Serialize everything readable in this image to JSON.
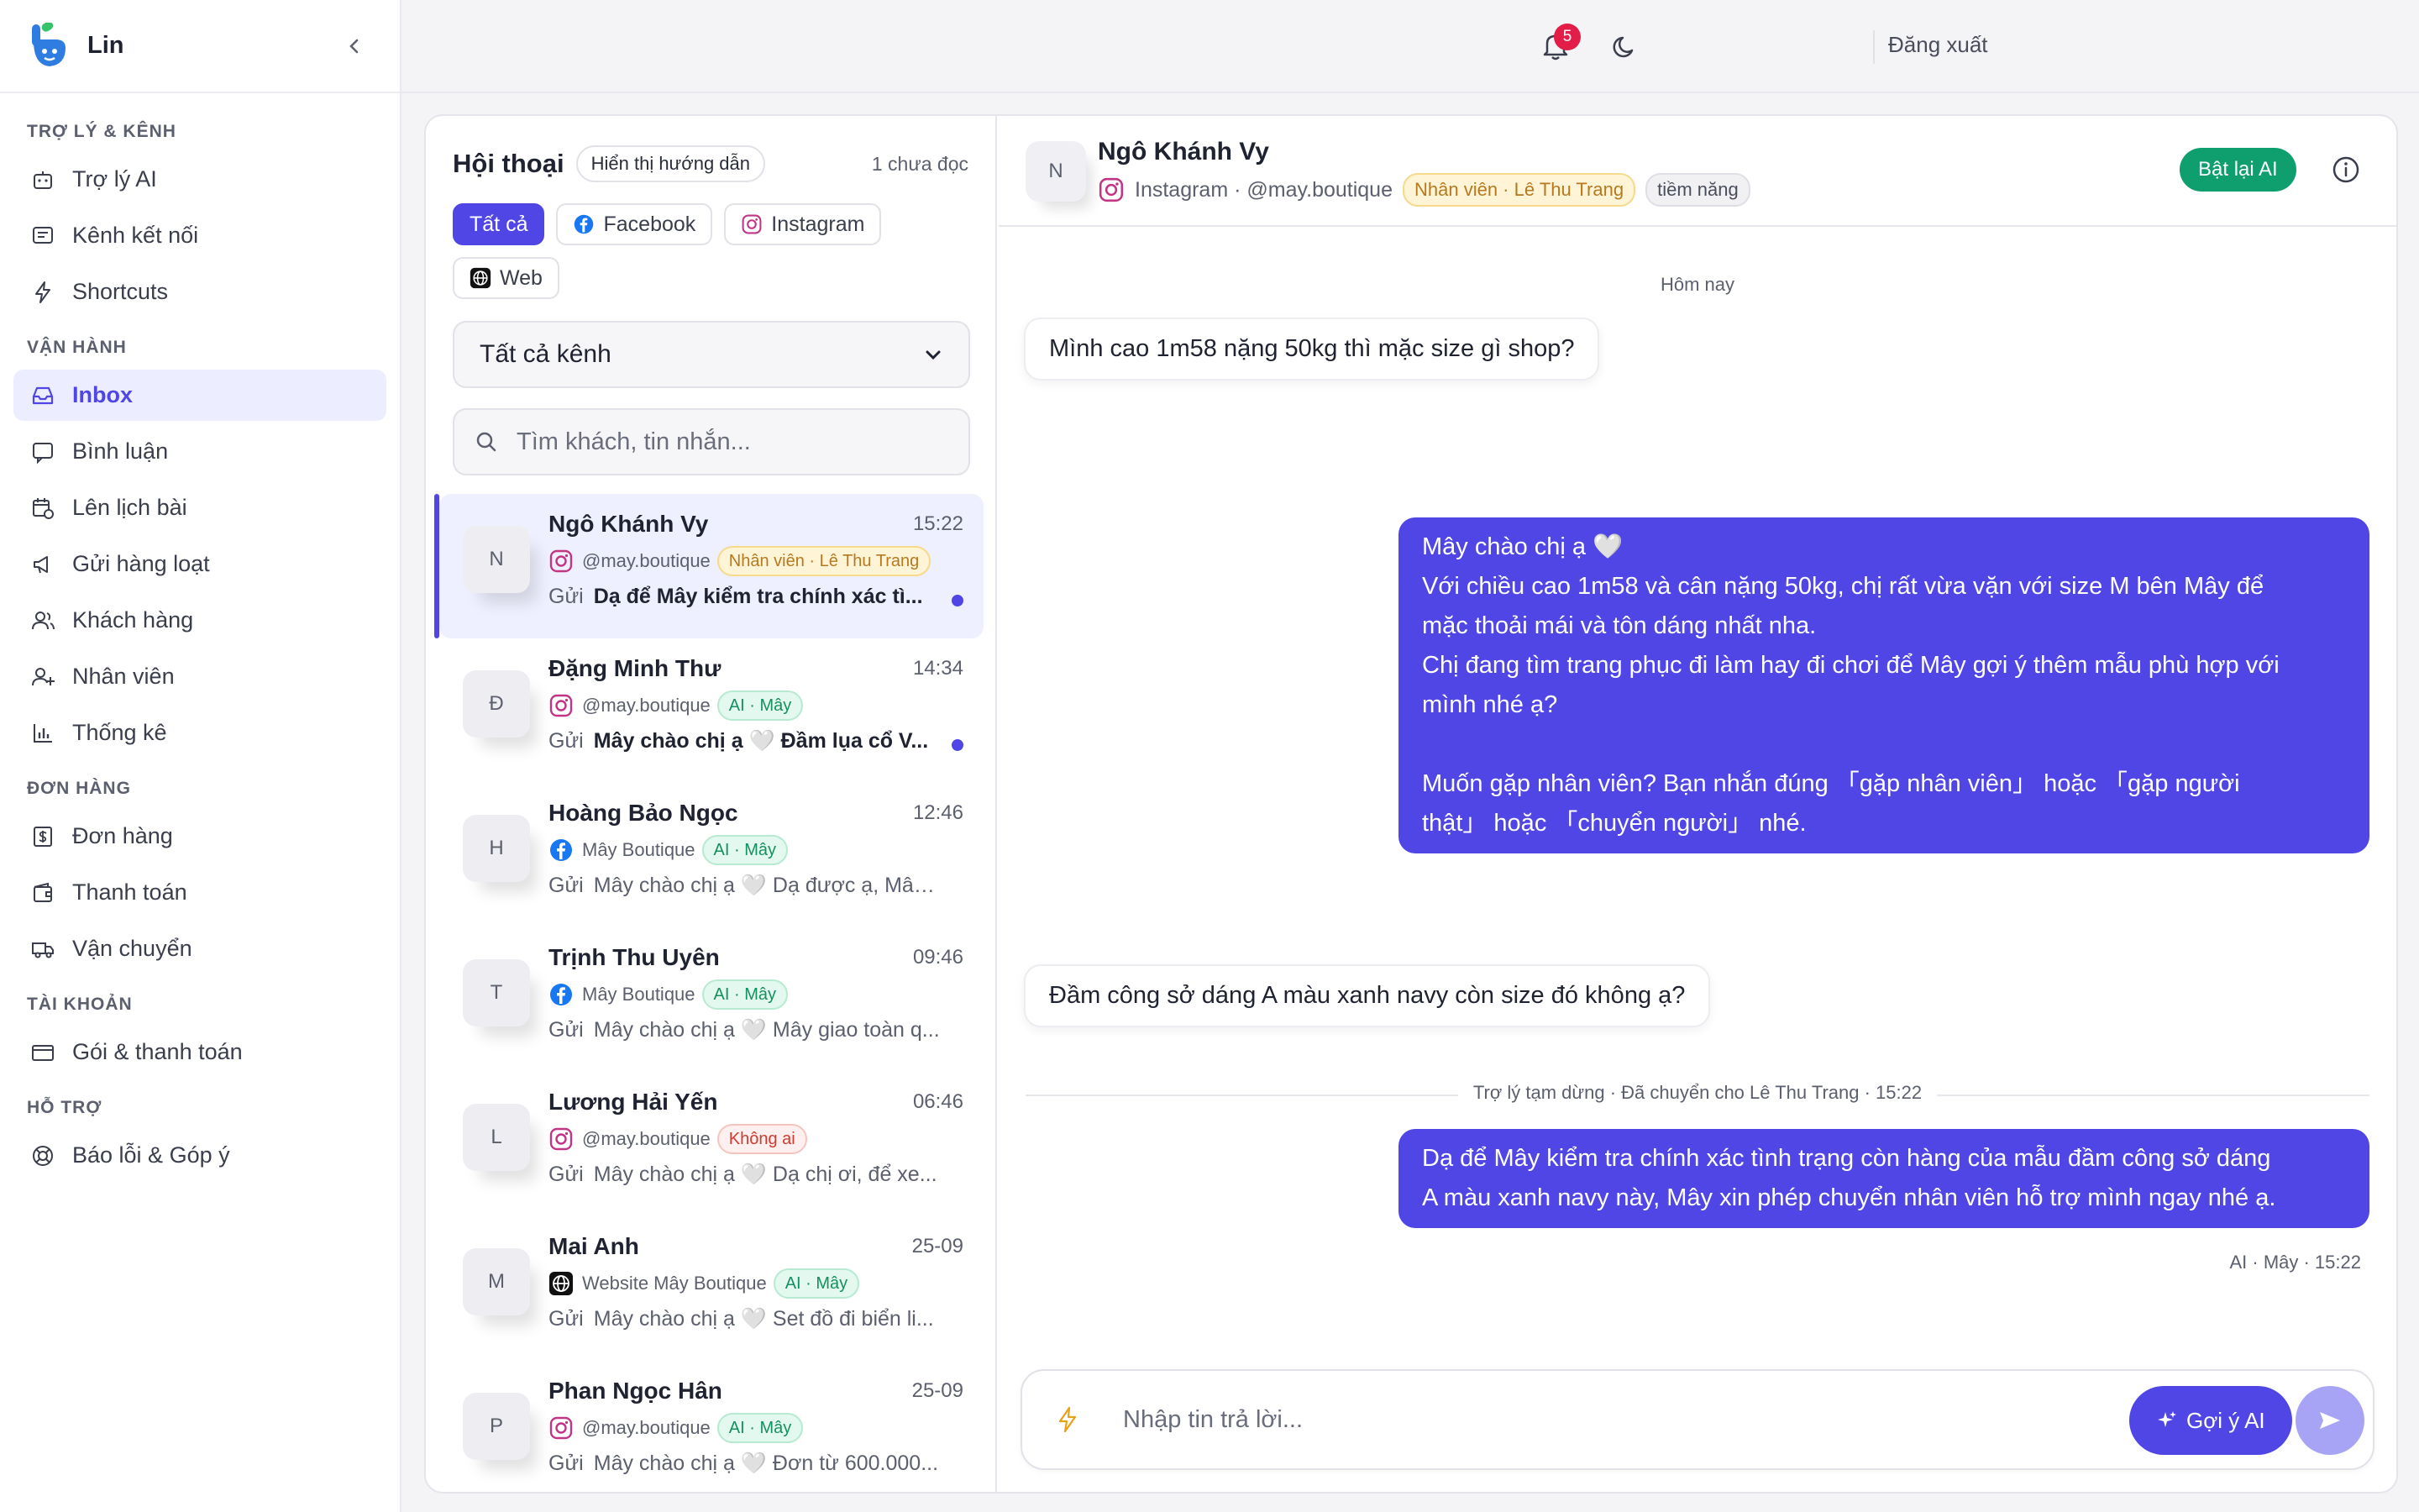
{
  "brand": {
    "name": "Lin"
  },
  "nav": {
    "sections": [
      {
        "title": "TRỢ LÝ & KÊNH",
        "items": [
          {
            "label": "Trợ lý AI",
            "icon": "bot-icon"
          },
          {
            "label": "Kênh kết nối",
            "icon": "chat-square-icon"
          },
          {
            "label": "Shortcuts",
            "icon": "lightning-icon"
          }
        ]
      },
      {
        "title": "VẬN HÀNH",
        "items": [
          {
            "label": "Inbox",
            "icon": "inbox-icon",
            "active": true
          },
          {
            "label": "Bình luận",
            "icon": "comment-icon"
          },
          {
            "label": "Lên lịch bài",
            "icon": "calendar-clock-icon"
          },
          {
            "label": "Gửi hàng loạt",
            "icon": "megaphone-icon"
          },
          {
            "label": "Khách hàng",
            "icon": "users-icon"
          },
          {
            "label": "Nhân viên",
            "icon": "user-plus-icon"
          },
          {
            "label": "Thống kê",
            "icon": "bar-chart-icon"
          }
        ]
      },
      {
        "title": "ĐƠN HÀNG",
        "items": [
          {
            "label": "Đơn hàng",
            "icon": "receipt-icon"
          },
          {
            "label": "Thanh toán",
            "icon": "wallet-icon"
          },
          {
            "label": "Vận chuyển",
            "icon": "truck-icon"
          }
        ]
      },
      {
        "title": "TÀI KHOẢN",
        "items": [
          {
            "label": "Gói & thanh toán",
            "icon": "credit-card-icon"
          }
        ]
      },
      {
        "title": "HỖ TRỢ",
        "items": [
          {
            "label": "Báo lỗi & Góp ý",
            "icon": "lifebuoy-icon"
          }
        ]
      }
    ]
  },
  "topbar": {
    "notification_count": "5",
    "logout_label": "Đăng xuất"
  },
  "conversations_panel": {
    "title": "Hội thoại",
    "guide_label": "Hiển thị hướng dẫn",
    "unread_label": "1 chưa đọc",
    "filters": [
      {
        "label": "Tất cả",
        "active": true,
        "icon": ""
      },
      {
        "label": "Facebook",
        "icon": "facebook-icon"
      },
      {
        "label": "Instagram",
        "icon": "instagram-icon"
      },
      {
        "label": "Web",
        "icon": "globe-icon"
      }
    ],
    "channel_select": "Tất cả kênh",
    "search_placeholder": "Tìm khách, tin nhắn...",
    "items": [
      {
        "initial": "N",
        "name": "Ngô Khánh Vy",
        "time": "15:22",
        "channel": "instagram-icon",
        "account": "@may.boutique",
        "tag": "Nhân viên · Lê Thu Trang",
        "tag_color": "amber",
        "sent": "Gửi",
        "last": "Dạ để Mây kiểm tra chính xác tì...",
        "unread": true,
        "active": true
      },
      {
        "initial": "Đ",
        "name": "Đặng Minh Thư",
        "time": "14:34",
        "channel": "instagram-icon",
        "account": "@may.boutique",
        "tag": "AI · Mây",
        "tag_color": "green",
        "sent": "Gửi",
        "last": "Mây chào chị ạ 🤍 Đầm lụa cổ V...",
        "unread": true
      },
      {
        "initial": "H",
        "name": "Hoàng Bảo Ngọc",
        "time": "12:46",
        "channel": "facebook-icon",
        "account": "Mây Boutique",
        "tag": "AI · Mây",
        "tag_color": "green",
        "sent": "Gửi",
        "last": "Mây chào chị ạ 🤍 Dạ được ạ, Mây ...",
        "unread": false
      },
      {
        "initial": "T",
        "name": "Trịnh Thu Uyên",
        "time": "09:46",
        "channel": "facebook-icon",
        "account": "Mây Boutique",
        "tag": "AI · Mây",
        "tag_color": "green",
        "sent": "Gửi",
        "last": "Mây chào chị ạ 🤍 Mây giao toàn q...",
        "unread": false
      },
      {
        "initial": "L",
        "name": "Lương Hải Yến",
        "time": "06:46",
        "channel": "instagram-icon",
        "account": "@may.boutique",
        "tag": "Không ai",
        "tag_color": "red",
        "sent": "Gửi",
        "last": "Mây chào chị ạ 🤍 Dạ chị ơi, để xe...",
        "unread": false
      },
      {
        "initial": "M",
        "name": "Mai Anh",
        "time": "25-09",
        "channel": "globe-icon",
        "account": "Website Mây Boutique",
        "tag": "AI · Mây",
        "tag_color": "green",
        "sent": "Gửi",
        "last": "Mây chào chị ạ 🤍 Set đồ đi biển li...",
        "unread": false
      },
      {
        "initial": "P",
        "name": "Phan Ngọc Hân",
        "time": "25-09",
        "channel": "instagram-icon",
        "account": "@may.boutique",
        "tag": "AI · Mây",
        "tag_color": "green",
        "sent": "Gửi",
        "last": "Mây chào chị ạ 🤍 Đơn từ 600.000...",
        "unread": false
      }
    ]
  },
  "chat": {
    "initial": "N",
    "name": "Ngô Khánh Vy",
    "meta": "Instagram · @may.boutique",
    "tag_staff": "Nhân viên · Lê Thu Trang",
    "tag_potential": "tiềm năng",
    "ai_button": "Bật lại AI",
    "day_label": "Hôm nay",
    "messages": [
      {
        "dir": "in",
        "text": "Mình cao 1m58 nặng 50kg thì mặc size gì shop?"
      },
      {
        "dir": "out",
        "text": "Mây chào chị ạ 🤍\nVới chiều cao 1m58 và cân nặng 50kg, chị rất vừa vặn với size M bên Mây để\nmặc thoải mái và tôn dáng nhất nha.\nChị đang tìm trang phục đi làm hay đi chơi để Mây gợi ý thêm mẫu phù hợp với\nmình nhé ạ?\n\nMuốn gặp nhân viên? Bạn nhắn đúng 「gặp nhân viên」 hoặc 「gặp người\nthật」 hoặc 「chuyển người」 nhé."
      },
      {
        "dir": "in",
        "text": "Đầm công sở dáng A màu xanh navy còn size đó không ạ?"
      },
      {
        "dir": "out",
        "text": "Dạ để Mây kiểm tra chính xác tình trạng còn hàng của mẫu đầm công sở dáng\nA màu xanh navy này, Mây xin phép chuyển nhân viên hỗ trợ mình ngay nhé ạ."
      }
    ],
    "handoff_note": "Trợ lý tạm dừng · Đã chuyển cho Lê Thu Trang · 15:22",
    "last_msg_meta": "AI · Mây · 15:22",
    "composer_placeholder": "Nhập tin trả lời...",
    "suggest_button": "Gợi ý AI"
  }
}
